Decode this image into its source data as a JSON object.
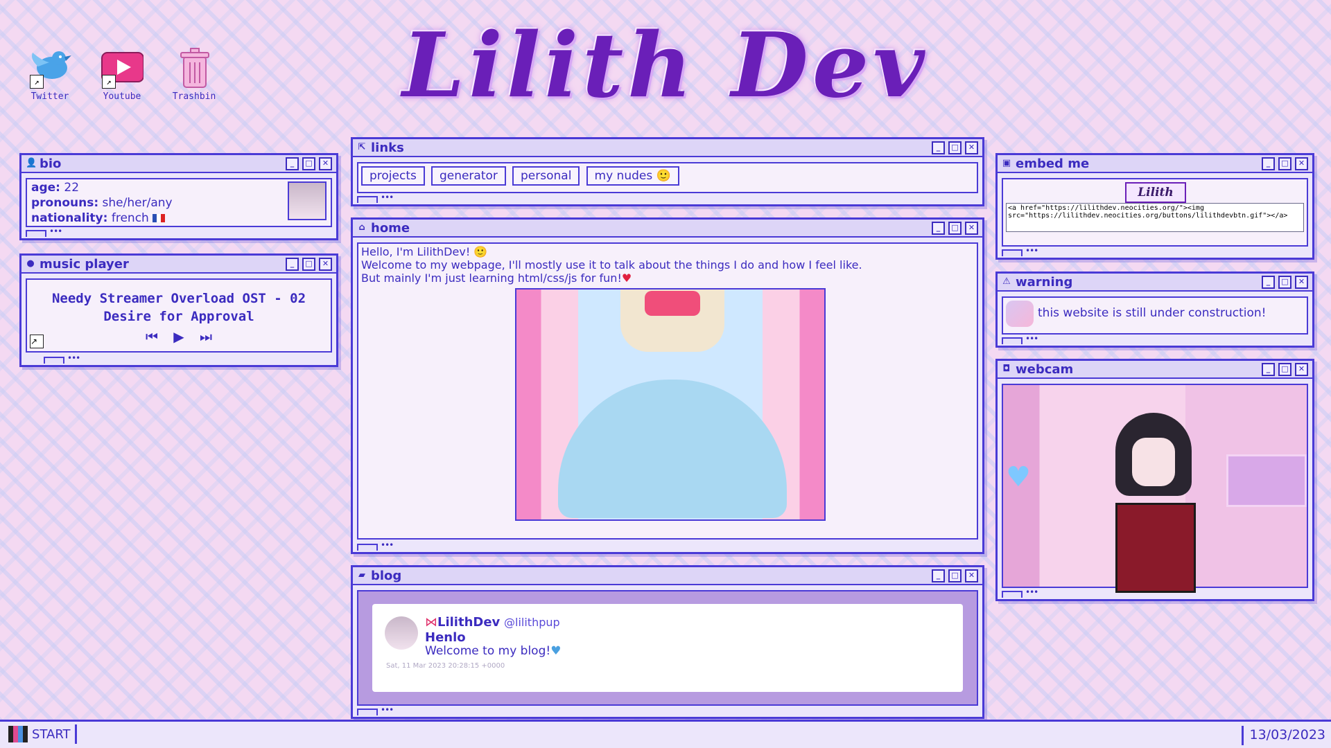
{
  "site_title": "Lilith Dev",
  "desktop_icons": [
    {
      "label": "Twitter"
    },
    {
      "label": "Youtube"
    },
    {
      "label": "Trashbin"
    }
  ],
  "bio": {
    "title": "bio",
    "age_label": "age:",
    "age": "22",
    "pronouns_label": "pronouns:",
    "pronouns": "she/her/any",
    "nationality_label": "nationality:",
    "nationality": "french"
  },
  "music": {
    "title": "music player",
    "track": "Needy Streamer Overload OST - 02 Desire for Approval"
  },
  "links": {
    "title": "links",
    "items": [
      "projects",
      "generator",
      "personal",
      "my nudes"
    ]
  },
  "home": {
    "title": "home",
    "line1": "Hello, I'm LilithDev!",
    "line2": "Welcome to my webpage, I'll mostly use it to talk about the things I do and how I feel like.",
    "line3": "But mainly I'm just learning html/css/js for fun!"
  },
  "blog": {
    "title": "blog",
    "author": "LilithDev",
    "handle": "@lilithpup",
    "post_title": "Henlo",
    "post_body": "Welcome to my blog!",
    "timestamp": "Sat, 11 Mar 2023 20:28:15 +0000"
  },
  "embed": {
    "title": "embed me",
    "button_text": "Lilith",
    "code": "<a href=\"https://lilithdev.neocities.org/\"><img src=\"https://lilithdev.neocities.org/buttons/lilithdevbtn.gif\"></a>"
  },
  "warning": {
    "title": "warning",
    "text": "this website is still under construction!"
  },
  "webcam": {
    "title": "webcam"
  },
  "taskbar": {
    "start": "START",
    "date": "13/03/2023"
  }
}
